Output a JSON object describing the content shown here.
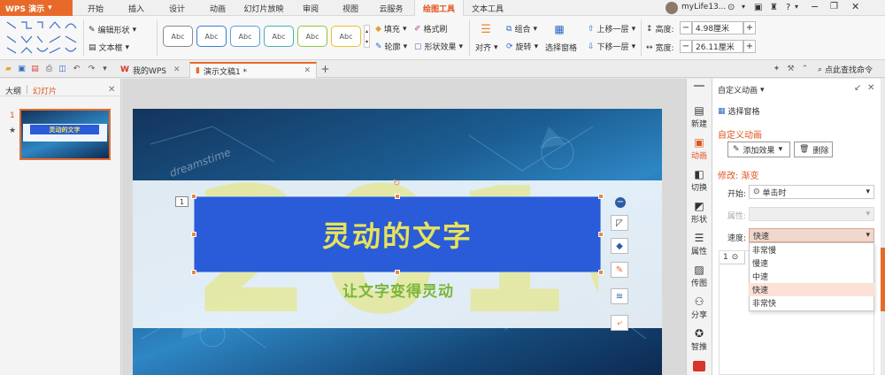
{
  "app": {
    "name": "WPS 演示",
    "user": "myLife13..."
  },
  "menu_tabs": [
    "开始",
    "插入",
    "设计",
    "动画",
    "幻灯片放映",
    "审阅",
    "视图",
    "云服务",
    "绘图工具",
    "文本工具"
  ],
  "active_menu_tab": "绘图工具",
  "ribbon": {
    "edit_shape": "编辑形状",
    "textbox": "文本框",
    "style_previews": [
      "Abc",
      "Abc",
      "Abc",
      "Abc",
      "Abc",
      "Abc"
    ],
    "fill": "填充",
    "outline": "轮廓",
    "format_painter": "格式刷",
    "shape_effects": "形状效果",
    "align": "对齐",
    "group": "组合",
    "rotate": "旋转",
    "selection_pane": "选择窗格",
    "bring_forward": "上移一层",
    "send_backward": "下移一层",
    "height_label": "高度:",
    "height_value": "4.98厘米",
    "width_label": "宽度:",
    "width_value": "26.11厘米"
  },
  "doc_tabs": {
    "home": "我的WPS",
    "current": "演示文稿1 *"
  },
  "search_command": "点此查找命令",
  "left_pane": {
    "tab_outline": "大纲",
    "tab_slides": "幻灯片",
    "slide_number": "1",
    "thumb_title": "灵动的文字"
  },
  "slide": {
    "title": "灵动的文字",
    "subtitle": "让文字变得灵动",
    "bg_year": "2010",
    "watermark": "dreamstime",
    "animation_tag": "1"
  },
  "sidebar": [
    "新建",
    "动画",
    "切换",
    "形状",
    "属性",
    "传图",
    "分享",
    "智推"
  ],
  "panel": {
    "title": "自定义动画",
    "selection_pane": "选择窗格",
    "section_title": "自定义动画",
    "add_effect": "添加效果",
    "delete": "删除",
    "modify_title": "修改: 渐变",
    "start_label": "开始:",
    "start_value": "单击时",
    "property_label": "属性:",
    "speed_label": "速度:",
    "speed_value": "快速",
    "speed_options": [
      "非常慢",
      "慢速",
      "中速",
      "快速",
      "非常快"
    ],
    "selected_speed": "快速",
    "list_index": "1"
  },
  "colors": {
    "accent": "#e86a2a",
    "title_box": "#2a5bd8",
    "title_text": "#e8e25a",
    "subtitle_text": "#7ab638",
    "panel_orange": "#e0541c"
  }
}
